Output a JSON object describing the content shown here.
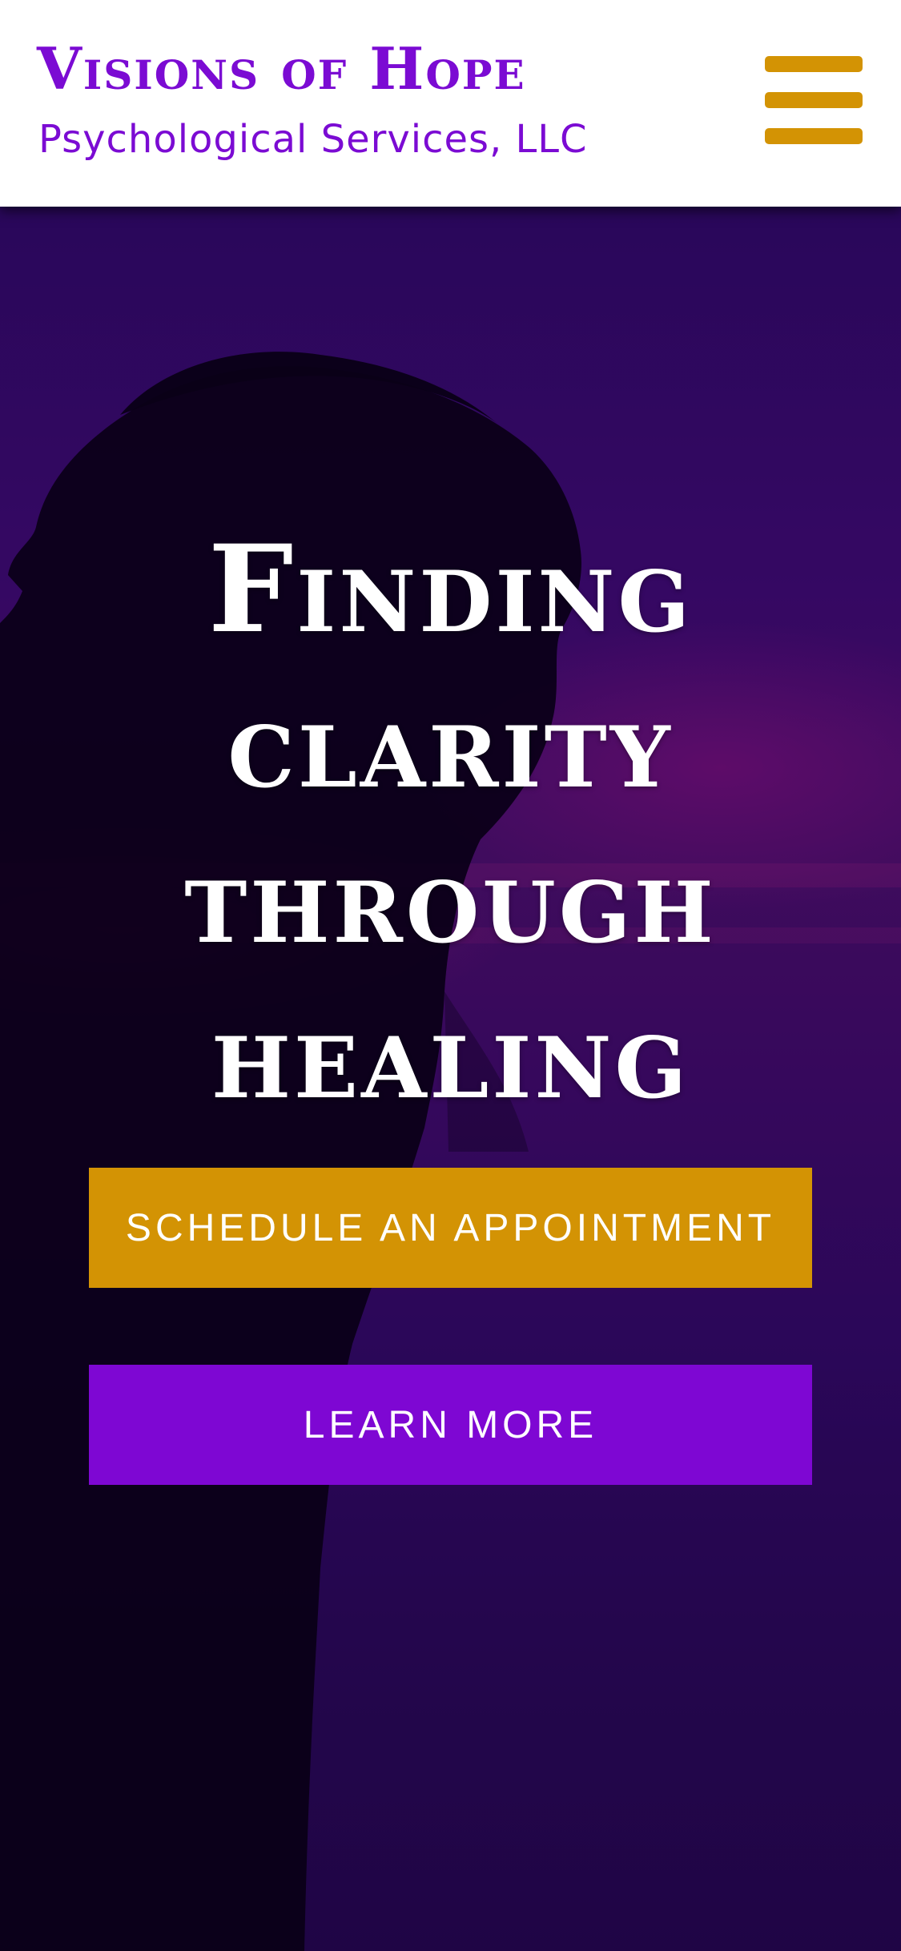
{
  "colors": {
    "brand_purple": "#7b0bd3",
    "accent_gold": "#d39304",
    "learn_more_purple": "#7e07d3",
    "header_bg": "#ffffff",
    "hero_text": "#ffffff"
  },
  "header": {
    "title": "Visions of Hope",
    "subtitle": "Psychological Services, LLC",
    "menu_icon": "hamburger-menu-icon"
  },
  "hero": {
    "heading_lines": [
      "Finding",
      "clarity",
      "through",
      "healing"
    ],
    "background_image": "silhouette-of-woman-at-sunset",
    "buttons": {
      "schedule_label": "SCHEDULE AN APPOINTMENT",
      "learn_more_label": "LEARN MORE"
    }
  }
}
